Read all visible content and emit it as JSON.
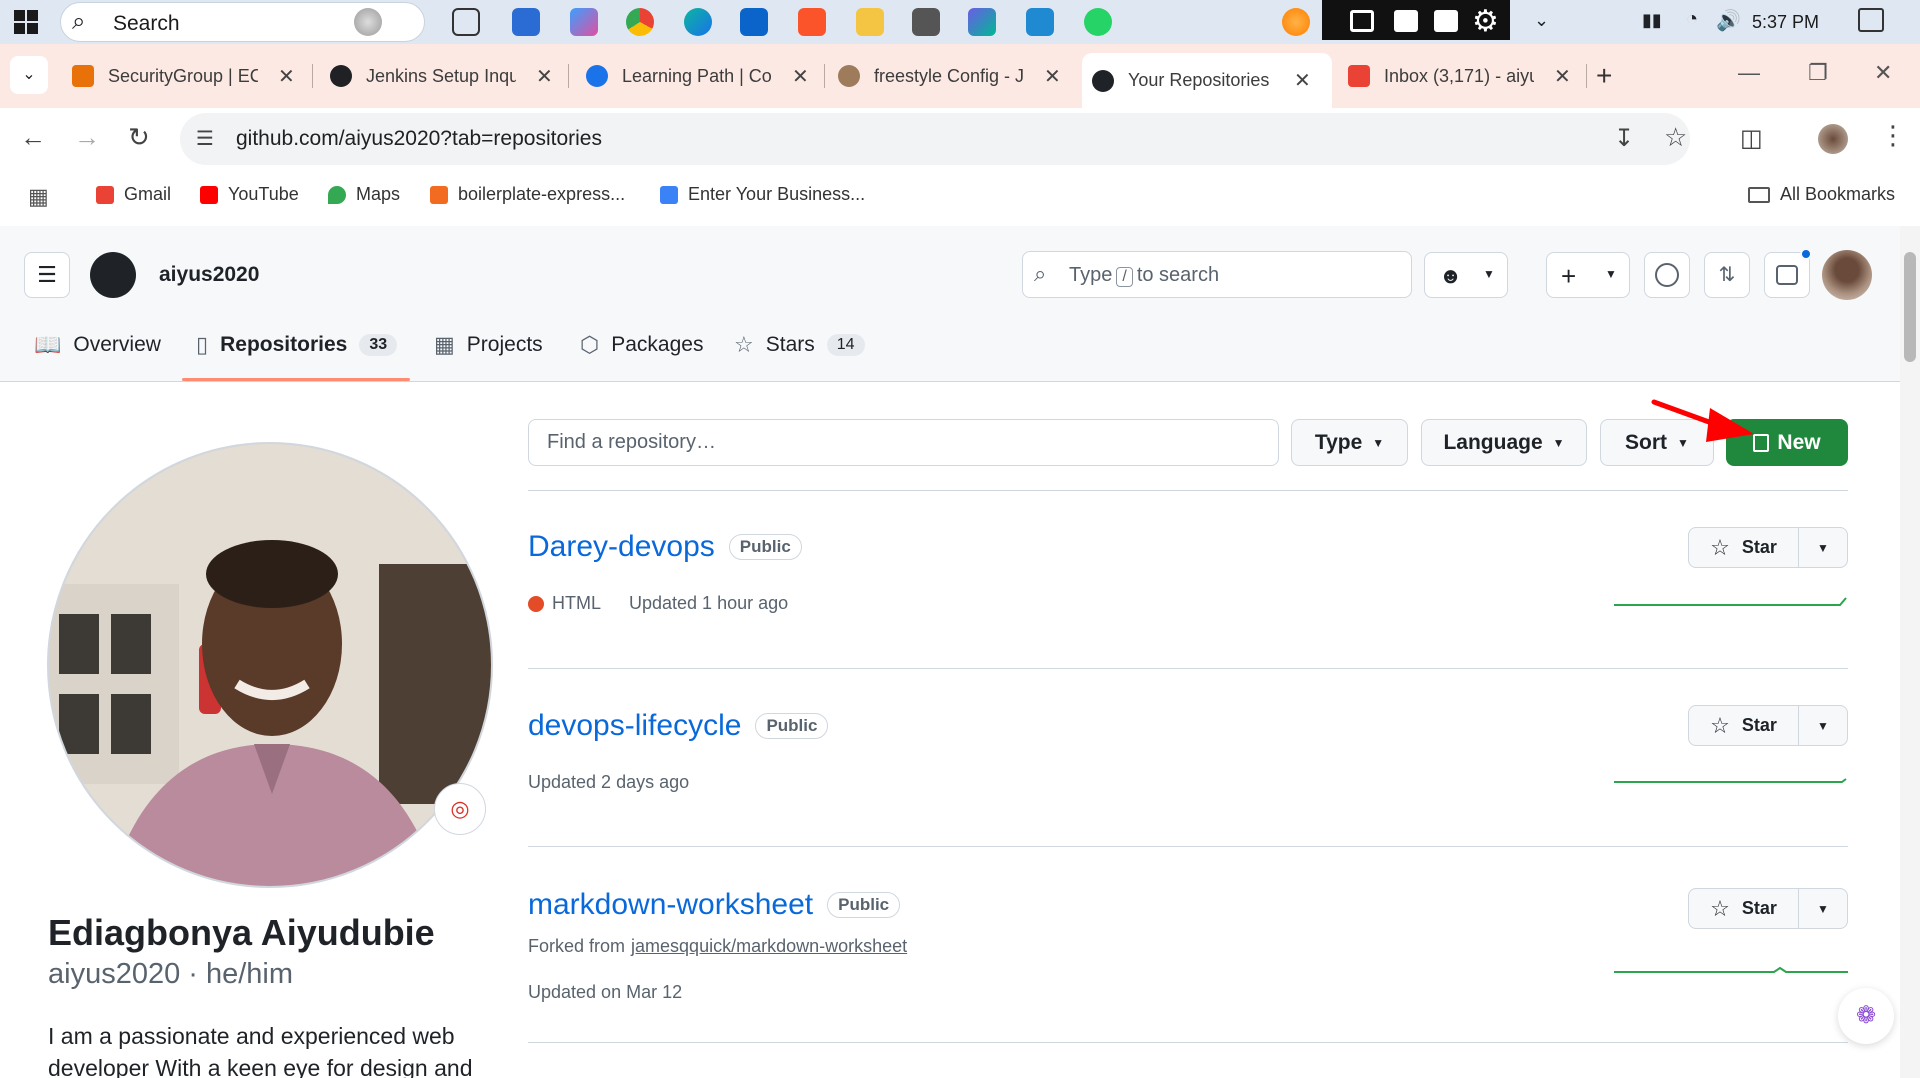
{
  "taskbar": {
    "search_label": "Search",
    "clock": "5:37 PM"
  },
  "browser": {
    "tabs": [
      {
        "label": "SecurityGroup | EC",
        "color": "#e8710a"
      },
      {
        "label": "Jenkins Setup Inqu",
        "color": "#202124"
      },
      {
        "label": "Learning Path | Col",
        "color": "#1a73e8"
      },
      {
        "label": "freestyle Config - J",
        "color": "#9e7b5a"
      },
      {
        "label": "Your Repositories",
        "color": "#1f2328"
      },
      {
        "label": "Inbox (3,171) - aiyu",
        "color": "#ea4335"
      }
    ],
    "url": "github.com/aiyus2020?tab=repositories",
    "bookmarks": [
      {
        "label": "Gmail",
        "color": "#ea4335"
      },
      {
        "label": "YouTube",
        "color": "#ff0000"
      },
      {
        "label": "Maps",
        "color": "#34a853"
      },
      {
        "label": "boilerplate-express...",
        "color": "#f26b21"
      },
      {
        "label": "Enter Your Business...",
        "color": "#3b82f6"
      }
    ],
    "all_bookmarks": "All Bookmarks"
  },
  "github": {
    "username": "aiyus2020",
    "search_before": "Type",
    "search_key": "/",
    "search_after": "to search",
    "nav": {
      "overview": "Overview",
      "repositories": "Repositories",
      "repositories_count": "33",
      "projects": "Projects",
      "packages": "Packages",
      "stars": "Stars",
      "stars_count": "14"
    },
    "profile": {
      "name": "Ediagbonya Aiyudubie",
      "login_line": "aiyus2020 · he/him",
      "bio": "I am a passionate and experienced web developer With a keen eye for design and"
    },
    "filter": {
      "find_placeholder": "Find a repository…",
      "type": "Type",
      "language": "Language",
      "sort": "Sort",
      "new": "New"
    },
    "repos": [
      {
        "name": "Darey-devops",
        "visibility": "Public",
        "language": "HTML",
        "updated": "Updated 1 hour ago",
        "star": "Star"
      },
      {
        "name": "devops-lifecycle",
        "visibility": "Public",
        "updated": "Updated 2 days ago",
        "star": "Star"
      },
      {
        "name": "markdown-worksheet",
        "visibility": "Public",
        "forked_prefix": "Forked from",
        "forked_from": "jamesqquick/markdown-worksheet",
        "updated": "Updated on Mar 12",
        "star": "Star"
      }
    ]
  },
  "colors": {
    "accent_green": "#1f883d",
    "link_blue": "#0969da",
    "tab_underline": "#fd8c73",
    "html_lang": "#e34c26",
    "annotation_arrow": "#ff0000"
  }
}
